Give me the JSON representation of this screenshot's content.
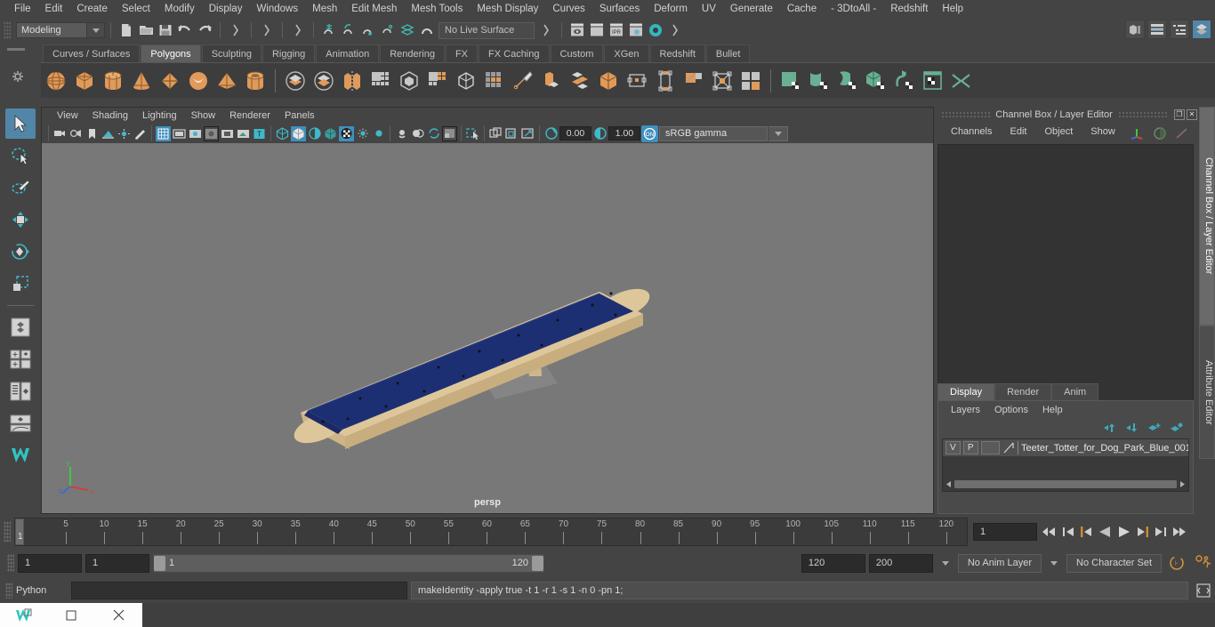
{
  "menubar": {
    "items": [
      "File",
      "Edit",
      "Create",
      "Select",
      "Modify",
      "Display",
      "Windows",
      "Mesh",
      "Edit Mesh",
      "Mesh Tools",
      "Mesh Display",
      "Curves",
      "Surfaces",
      "Deform",
      "UV",
      "Generate",
      "Cache",
      "- 3DtoAll -",
      "Redshift",
      "Help"
    ]
  },
  "statusbar": {
    "menuset": "Modeling",
    "live_surface": "No Live Surface",
    "icons": [
      "new-scene-icon",
      "open-scene-icon",
      "save-scene-icon",
      "undo-icon",
      "redo-icon",
      "select-by-hierarchy-icon",
      "select-by-object-icon",
      "select-by-component-icon",
      "snap-to-grid-icon",
      "snap-to-curve-icon",
      "snap-to-point-icon",
      "snap-to-projected-center-icon",
      "snap-to-view-plane-icon",
      "render-view-icon",
      "render-sequence-icon",
      "ipr-render-icon",
      "render-settings-icon",
      "hypershade-icon"
    ],
    "topright_icons": [
      "modeling-toolkit-icon",
      "attribute-editor-icon",
      "outliner-icon",
      "channel-box-icon"
    ]
  },
  "shelf": {
    "tabs": [
      "Curves / Surfaces",
      "Polygons",
      "Sculpting",
      "Rigging",
      "Animation",
      "Rendering",
      "FX",
      "FX Caching",
      "Custom",
      "XGen",
      "Redshift",
      "Bullet"
    ],
    "active_tab": "Polygons",
    "items": [
      {
        "name": "poly-sphere-icon",
        "group": "prim"
      },
      {
        "name": "poly-cube-icon",
        "group": "prim"
      },
      {
        "name": "poly-cylinder-icon",
        "group": "prim"
      },
      {
        "name": "poly-cone-icon",
        "group": "prim"
      },
      {
        "name": "poly-plane-icon",
        "group": "prim"
      },
      {
        "name": "poly-torus-icon",
        "group": "prim"
      },
      {
        "name": "poly-pyramid-icon",
        "group": "prim"
      },
      {
        "name": "poly-pipe-icon",
        "group": "prim"
      },
      {
        "name": "boolean-union-icon",
        "group": "op"
      },
      {
        "name": "boolean-difference-icon",
        "group": "op"
      },
      {
        "name": "combine-icon",
        "group": "op"
      },
      {
        "name": "separate-icon",
        "group": "op"
      },
      {
        "name": "smooth-icon",
        "group": "op"
      },
      {
        "name": "mirror-icon",
        "group": "op"
      },
      {
        "name": "extrude-icon",
        "group": "op"
      },
      {
        "name": "bevel-icon",
        "group": "op"
      },
      {
        "name": "multi-cut-icon",
        "group": "op"
      },
      {
        "name": "bridge-icon",
        "group": "op"
      },
      {
        "name": "append-polygon-icon",
        "group": "op"
      },
      {
        "name": "fill-hole-icon",
        "group": "op"
      },
      {
        "name": "target-weld-icon",
        "group": "op"
      },
      {
        "name": "quad-draw-icon",
        "group": "op"
      },
      {
        "name": "uv-editor-icon",
        "group": "uv"
      },
      {
        "name": "uv-planar-icon",
        "group": "uv"
      },
      {
        "name": "uv-cylindrical-icon",
        "group": "uv"
      },
      {
        "name": "uv-automatic-icon",
        "group": "uv"
      },
      {
        "name": "uv-unfold-icon",
        "group": "uv"
      },
      {
        "name": "uv-layout-icon",
        "group": "uv"
      },
      {
        "name": "uv-cut-icon",
        "group": "uv"
      }
    ]
  },
  "toolbox": {
    "tools": [
      {
        "name": "select-tool",
        "selected": true
      },
      {
        "name": "lasso-select-tool",
        "selected": false
      },
      {
        "name": "paint-select-tool",
        "selected": false
      },
      {
        "name": "move-tool",
        "selected": false
      },
      {
        "name": "rotate-tool",
        "selected": false
      },
      {
        "name": "scale-tool",
        "selected": false
      },
      {
        "name": "last-tool",
        "selected": false
      },
      {
        "name": "layout-single-pane",
        "selected": false
      },
      {
        "name": "layout-four-pane",
        "selected": false
      },
      {
        "name": "layout-outliner-persp",
        "selected": false
      },
      {
        "name": "layout-persp-graph",
        "selected": false
      },
      {
        "name": "maya-logo",
        "selected": false
      }
    ]
  },
  "viewport_panel": {
    "menu": [
      "View",
      "Shading",
      "Lighting",
      "Show",
      "Renderer",
      "Panels"
    ],
    "camera_label": "persp",
    "toolbar": {
      "value_a": "0.00",
      "value_b": "1.00",
      "gamma": "sRGB gamma",
      "icons": [
        "select-camera-icon",
        "camera-attributes-icon",
        "bookmark-icon",
        "image-plane-icon",
        "two-sided-lighting-icon",
        "grease-pencil-icon",
        "grid-icon",
        "film-gate-icon",
        "resolution-gate-icon",
        "gate-mask-icon",
        "xray-icon",
        "xray-joints-icon",
        "texture-icon",
        "wireframe-shaded-icon",
        "smooth-shade-all-icon",
        "hardware-texturing-icon",
        "use-default-material-icon",
        "xray-shading-icon",
        "shadows-icon",
        "screen-space-ao-icon",
        "motion-blur-icon",
        "multisample-icon",
        "isolate-select-icon",
        "exposure-icon",
        "gamma-icon",
        "view-transform-toggle-icon"
      ]
    },
    "scene": {
      "object_name": "Teeter Totter for Dog Park Blue",
      "deck_color": "#1d2f73",
      "frame_color": "#ddc79a",
      "background_color": "#787878"
    }
  },
  "right_dock": {
    "title": "Channel Box / Layer Editor",
    "menus": [
      "Channels",
      "Edit",
      "Object",
      "Show"
    ],
    "layer_editor": {
      "tabs": [
        "Display",
        "Render",
        "Anim"
      ],
      "active_tab": "Display",
      "menus": [
        "Layers",
        "Options",
        "Help"
      ],
      "toolbar_icons": [
        "move-layer-up-icon",
        "move-layer-down-icon",
        "new-layer-icon",
        "new-layer-from-selected-icon"
      ],
      "layers": [
        {
          "visibility": "V",
          "playback": "P",
          "color": "",
          "name": "Teeter_Totter_for_Dog_Park_Blue_001"
        }
      ]
    },
    "vertical_tabs": [
      "Channel Box / Layer Editor",
      "Attribute Editor"
    ],
    "active_vertical_tab": "Channel Box / Layer Editor"
  },
  "timeline": {
    "ticks": [
      5,
      10,
      15,
      20,
      25,
      30,
      35,
      40,
      45,
      50,
      55,
      60,
      65,
      70,
      75,
      80,
      85,
      90,
      95,
      100,
      105,
      110,
      115,
      120
    ],
    "current_frame_marker": "1",
    "current_frame_field": "1",
    "playback_icons": [
      "go-to-start-icon",
      "step-back-keyframe-icon",
      "step-back-frame-icon",
      "play-backwards-icon",
      "play-forwards-icon",
      "step-forward-frame-icon",
      "step-forward-keyframe-icon",
      "go-to-end-icon"
    ]
  },
  "range_bar": {
    "anim_start": "1",
    "range_start": "1",
    "slider_start_label": "1",
    "slider_end_label": "120",
    "range_end": "120",
    "anim_end": "200",
    "anim_layer": "No Anim Layer",
    "character_set": "No Character Set",
    "icons": [
      "auto-keyframe-icon",
      "animation-preferences-icon"
    ]
  },
  "command_line": {
    "language": "Python",
    "input_value": "",
    "output": "makeIdentity -apply true -t 1 -r 1 -s 1 -n 0 -pn 1;",
    "script-editor-icon": "script-editor-icon"
  },
  "taskbar": {
    "buttons": [
      "maya-app-icon",
      "restore-window-icon",
      "minimize-window-icon",
      "close-window-icon"
    ]
  }
}
